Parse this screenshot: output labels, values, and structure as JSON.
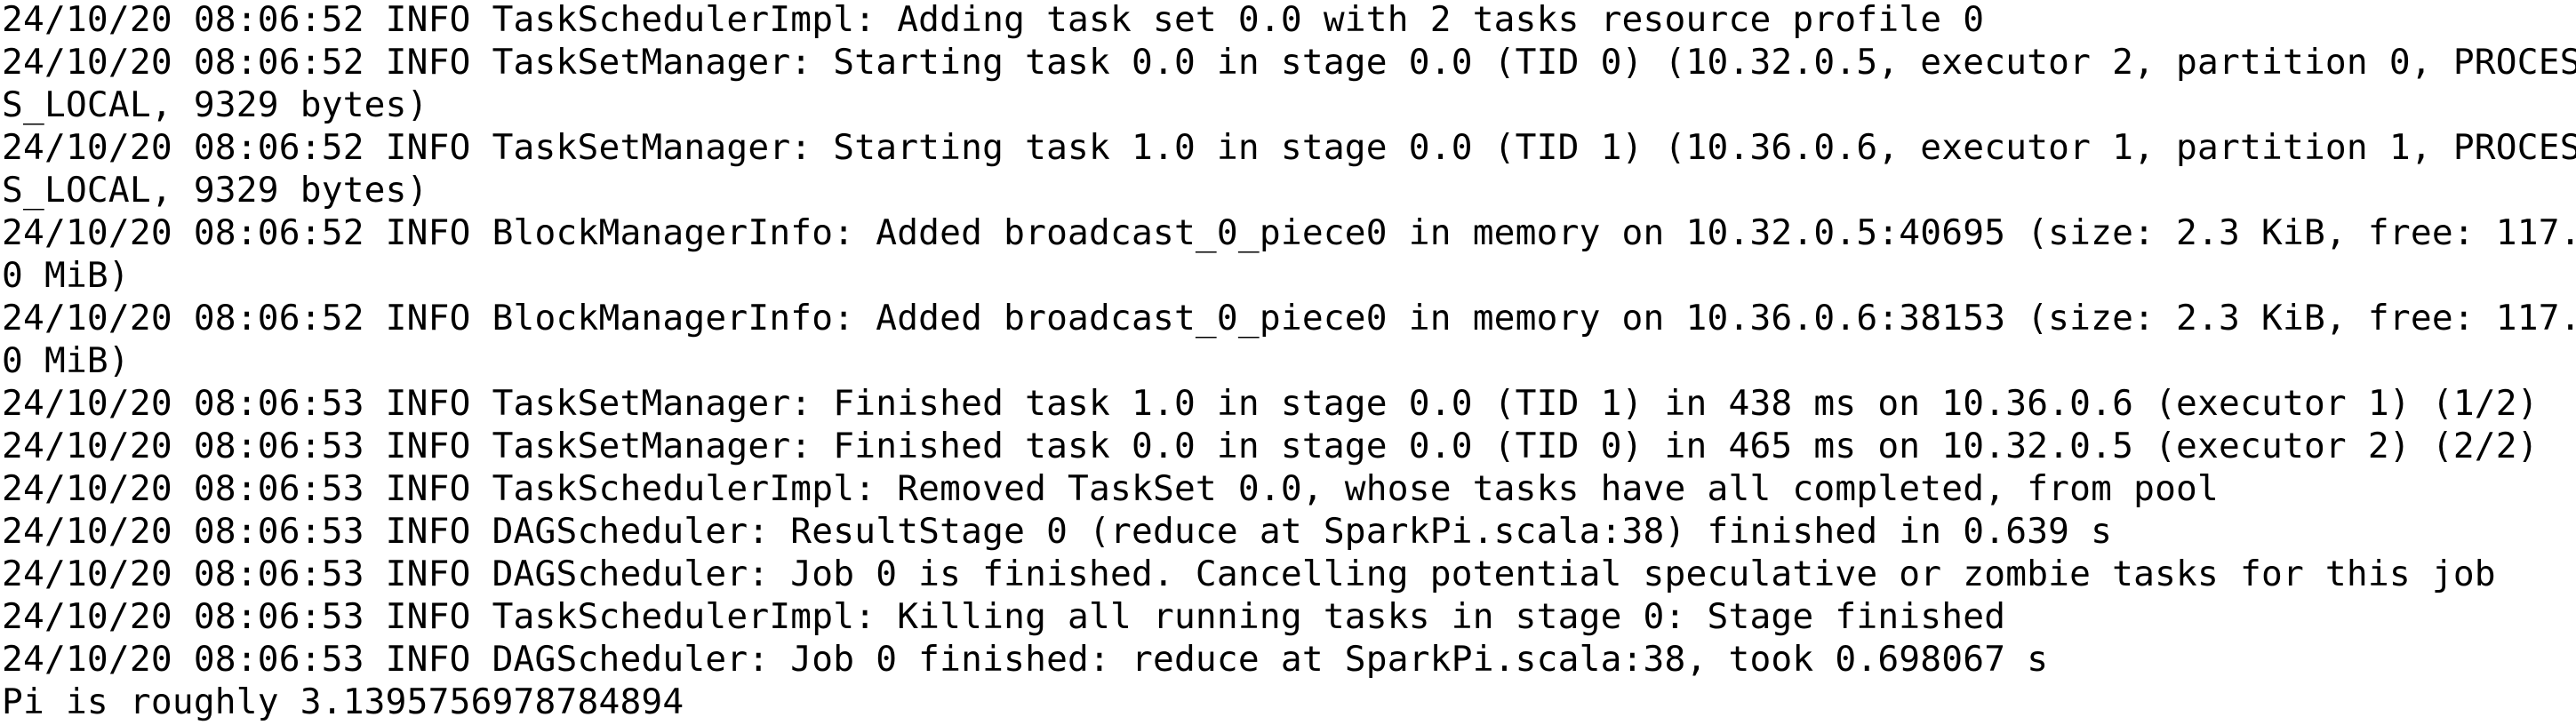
{
  "terminal": {
    "lines": [
      "24/10/20 08:06:52 INFO TaskSchedulerImpl: Adding task set 0.0 with 2 tasks resource profile 0",
      "24/10/20 08:06:52 INFO TaskSetManager: Starting task 0.0 in stage 0.0 (TID 0) (10.32.0.5, executor 2, partition 0, PROCES",
      "S_LOCAL, 9329 bytes)",
      "24/10/20 08:06:52 INFO TaskSetManager: Starting task 1.0 in stage 0.0 (TID 1) (10.36.0.6, executor 1, partition 1, PROCES",
      "S_LOCAL, 9329 bytes)",
      "24/10/20 08:06:52 INFO BlockManagerInfo: Added broadcast_0_piece0 in memory on 10.32.0.5:40695 (size: 2.3 KiB, free: 117.",
      "0 MiB)",
      "24/10/20 08:06:52 INFO BlockManagerInfo: Added broadcast_0_piece0 in memory on 10.36.0.6:38153 (size: 2.3 KiB, free: 117.",
      "0 MiB)",
      "24/10/20 08:06:53 INFO TaskSetManager: Finished task 1.0 in stage 0.0 (TID 1) in 438 ms on 10.36.0.6 (executor 1) (1/2)",
      "24/10/20 08:06:53 INFO TaskSetManager: Finished task 0.0 in stage 0.0 (TID 0) in 465 ms on 10.32.0.5 (executor 2) (2/2)",
      "24/10/20 08:06:53 INFO TaskSchedulerImpl: Removed TaskSet 0.0, whose tasks have all completed, from pool",
      "24/10/20 08:06:53 INFO DAGScheduler: ResultStage 0 (reduce at SparkPi.scala:38) finished in 0.639 s",
      "24/10/20 08:06:53 INFO DAGScheduler: Job 0 is finished. Cancelling potential speculative or zombie tasks for this job",
      "24/10/20 08:06:53 INFO TaskSchedulerImpl: Killing all running tasks in stage 0: Stage finished",
      "24/10/20 08:06:53 INFO DAGScheduler: Job 0 finished: reduce at SparkPi.scala:38, took 0.698067 s",
      "Pi is roughly 3.1395756978784894"
    ]
  },
  "colors": {
    "background": "#ffffff",
    "text": "#000000"
  }
}
